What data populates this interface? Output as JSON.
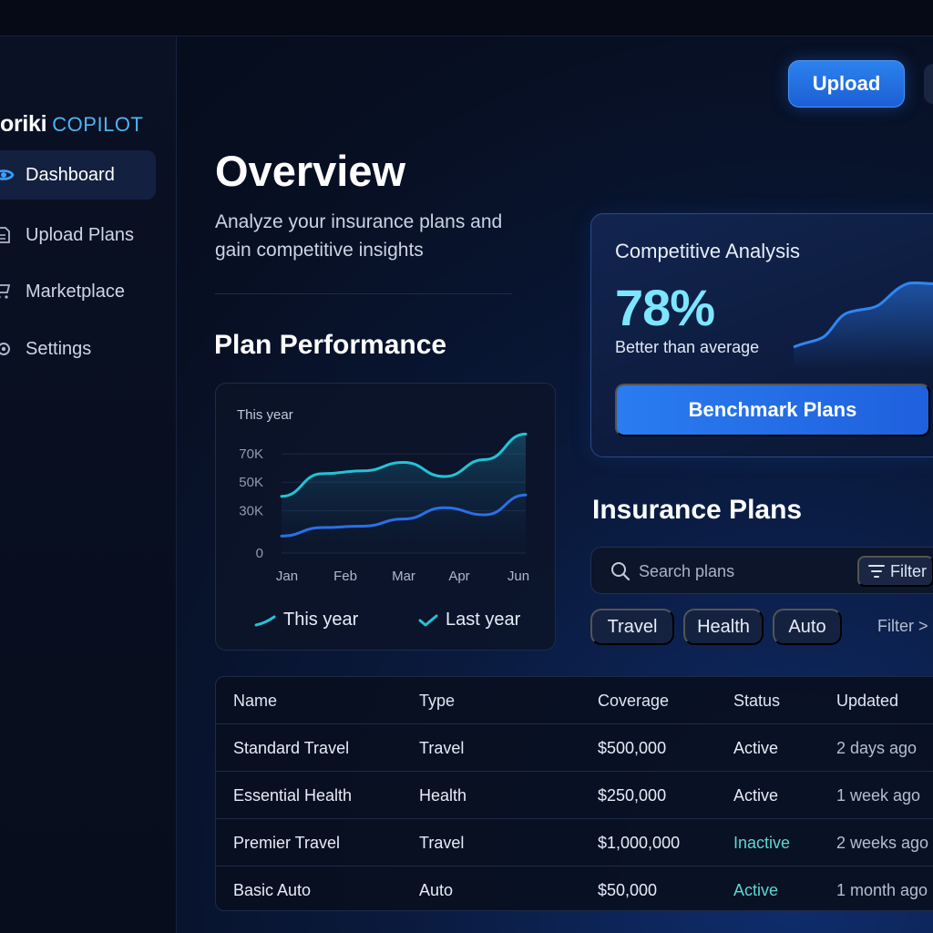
{
  "brand": {
    "name": "oriki",
    "suffix": "COPILOT"
  },
  "sidebar": {
    "items": [
      {
        "label": "Dashboard",
        "icon": "dashboard-icon",
        "active": true
      },
      {
        "label": "Upload Plans",
        "icon": "upload-plans-icon",
        "active": false
      },
      {
        "label": "Marketplace",
        "icon": "marketplace-icon",
        "active": false
      },
      {
        "label": "Settings",
        "icon": "settings-icon",
        "active": false
      }
    ]
  },
  "header": {
    "upload_label": "Upload"
  },
  "main": {
    "title": "Overview",
    "subtitle": "Analyze your insurance plans and gain competitive insights",
    "performance_heading": "Plan Performance"
  },
  "chart_data": {
    "type": "line",
    "subtitle": "This year",
    "categories": [
      "Jan",
      "Feb",
      "Mar",
      "Apr",
      "Jun"
    ],
    "y_ticks": [
      "0",
      "30K",
      "50K",
      "70K"
    ],
    "series": [
      {
        "name": "This year",
        "color": "#22c3d6",
        "values": [
          40,
          56,
          58,
          64,
          54,
          66,
          84
        ]
      },
      {
        "name": "Last year",
        "color": "#2b6fe8",
        "values": [
          12,
          18,
          19,
          24,
          32,
          27,
          41
        ]
      }
    ],
    "legend": [
      "This year",
      "Last year"
    ],
    "legend_placement": "bottom"
  },
  "competitive": {
    "title": "Competitive Analysis",
    "percent": "78%",
    "caption": "Better than average",
    "button_label": "Benchmark Plans"
  },
  "plans": {
    "heading": "Insurance Plans",
    "search_placeholder": "Search plans",
    "filter_label": "Filter",
    "chips": [
      "Travel",
      "Health",
      "Auto"
    ],
    "filter_link": "Filter >",
    "columns": [
      "Name",
      "Type",
      "Coverage",
      "Status",
      "Updated"
    ],
    "rows": [
      {
        "name": "Standard Travel",
        "type": "Travel",
        "coverage": "$500,000",
        "status": "Active",
        "updated": "2 days ago",
        "status_color": "#e6ecf7"
      },
      {
        "name": "Essential Health",
        "type": "Health",
        "coverage": "$250,000",
        "status": "Active",
        "updated": "1 week ago",
        "status_color": "#e6ecf7"
      },
      {
        "name": "Premier Travel",
        "type": "Travel",
        "coverage": "$1,000,000",
        "status": "Inactive",
        "updated": "2 weeks ago",
        "status_color": "#5fd6d0"
      },
      {
        "name": "Basic Auto",
        "type": "Auto",
        "coverage": "$50,000",
        "status": "Active",
        "updated": "1 month ago",
        "status_color": "#5fd6d0"
      }
    ]
  },
  "colors": {
    "accent": "#2b7cf0",
    "teal": "#22c3d6",
    "highlight": "#7de6ff"
  }
}
